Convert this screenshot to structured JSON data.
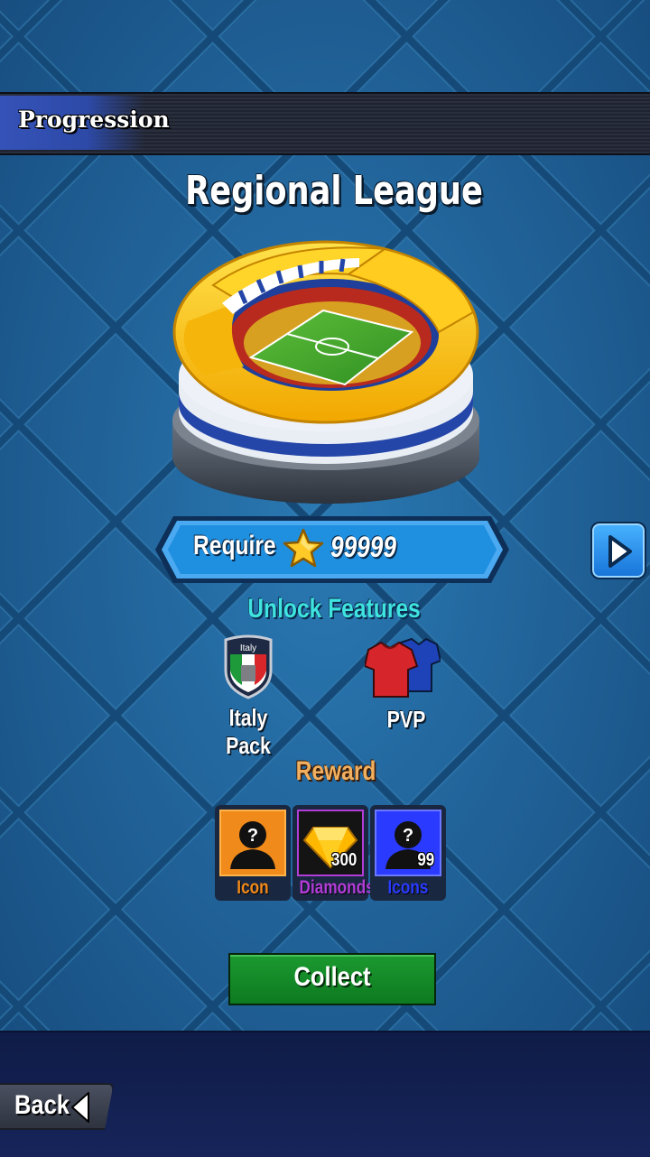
{
  "header": {
    "title": "Progression"
  },
  "league": {
    "title": "Regional League"
  },
  "requirement": {
    "label": "Require",
    "value": "99999",
    "icon": "star-icon"
  },
  "unlock": {
    "title": "Unlock Features",
    "items": [
      {
        "label": "Italy Pack",
        "icon": "italy-shield-icon",
        "badge_text": "Italy"
      },
      {
        "label": "PVP",
        "icon": "jersey-icon"
      }
    ]
  },
  "reward": {
    "title": "Reward",
    "items": [
      {
        "label": "Icon",
        "count": "",
        "color": "#f08a1a",
        "icon": "mystery-player-icon"
      },
      {
        "label": "Diamonds",
        "count": "300",
        "color": "#b23dd8",
        "icon": "diamond-icon"
      },
      {
        "label": "Icons",
        "count": "99",
        "color": "#2a3bff",
        "icon": "mystery-player-icon"
      }
    ]
  },
  "actions": {
    "collect_label": "Collect",
    "back_label": "Back"
  },
  "colors": {
    "unlock_title": "#3fe3e0",
    "reward_title": "#f0b060",
    "collect_button": "#138a28",
    "require_pill": "#1f8fe0"
  }
}
